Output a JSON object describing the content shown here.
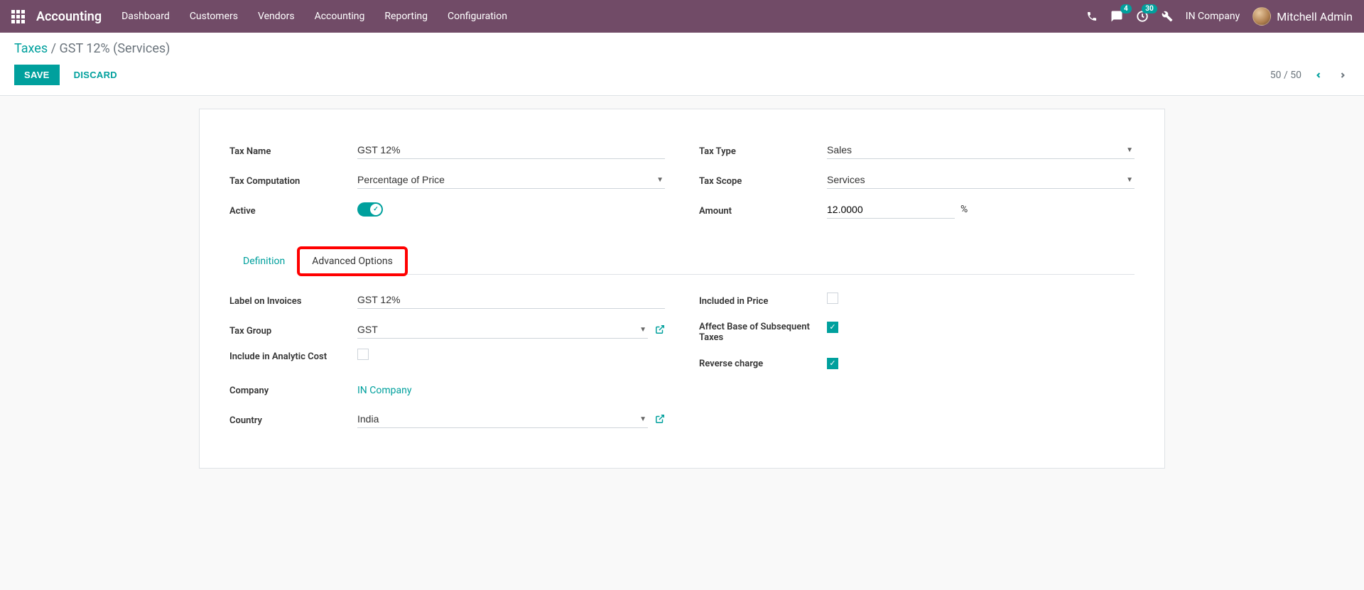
{
  "navbar": {
    "brand": "Accounting",
    "menu": [
      "Dashboard",
      "Customers",
      "Vendors",
      "Accounting",
      "Reporting",
      "Configuration"
    ],
    "msg_badge": "4",
    "activity_badge": "30",
    "company": "IN Company",
    "user": "Mitchell Admin"
  },
  "breadcrumb": {
    "root": "Taxes",
    "sep": " / ",
    "current": "GST 12% (Services)"
  },
  "buttons": {
    "save": "SAVE",
    "discard": "DISCARD"
  },
  "pager": {
    "text": "50 / 50"
  },
  "form": {
    "left": {
      "tax_name_label": "Tax Name",
      "tax_name_value": "GST 12%",
      "tax_computation_label": "Tax Computation",
      "tax_computation_value": "Percentage of Price",
      "active_label": "Active"
    },
    "right": {
      "tax_type_label": "Tax Type",
      "tax_type_value": "Sales",
      "tax_scope_label": "Tax Scope",
      "tax_scope_value": "Services",
      "amount_label": "Amount",
      "amount_value": "12.0000",
      "amount_unit": "%"
    }
  },
  "tabs": {
    "definition": "Definition",
    "advanced": "Advanced Options"
  },
  "adv": {
    "left": {
      "label_invoices_label": "Label on Invoices",
      "label_invoices_value": "GST 12%",
      "tax_group_label": "Tax Group",
      "tax_group_value": "GST",
      "analytic_label": "Include in Analytic Cost",
      "company_label": "Company",
      "company_value": "IN Company",
      "country_label": "Country",
      "country_value": "India"
    },
    "right": {
      "included_price_label": "Included in Price",
      "affect_base_label": "Affect Base of Subsequent Taxes",
      "reverse_charge_label": "Reverse charge"
    }
  }
}
